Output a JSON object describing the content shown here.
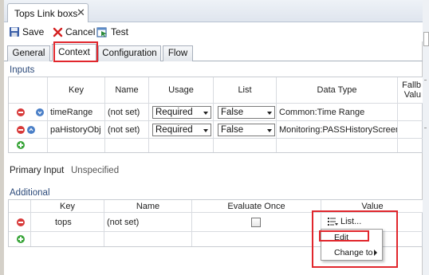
{
  "editor": {
    "tab_title": "Tops Link boxs"
  },
  "toolbar": {
    "save_label": "Save",
    "cancel_label": "Cancel",
    "test_label": "Test"
  },
  "subtabs": [
    "General",
    "Context",
    "Configuration",
    "Flow"
  ],
  "inputs": {
    "section_label": "Inputs",
    "columns": [
      "Key",
      "Name",
      "Usage",
      "List",
      "Data Type",
      "Fallb",
      "Valu"
    ],
    "rows": [
      {
        "key": "timeRange",
        "name": "(not set)",
        "usage": "Required",
        "list": "False",
        "data_type": "Common:Time Range"
      },
      {
        "key": "paHistoryObj",
        "name": "(not set)",
        "usage": "Required",
        "list": "False",
        "data_type": "Monitoring:PASSHistoryScreen"
      }
    ]
  },
  "primary_input": {
    "label": "Primary Input",
    "value": "Unspecified"
  },
  "additional": {
    "section_label": "Additional",
    "columns": [
      "Key",
      "Name",
      "Evaluate Once",
      "Value"
    ],
    "rows": [
      {
        "key": "tops",
        "name": "(not set)",
        "evaluate_once": false,
        "value": "List..."
      }
    ]
  },
  "context_menu": {
    "items": [
      "Edit",
      "Change to"
    ]
  },
  "colors": {
    "highlight": "#e1262c",
    "section_text": "#2c4a7a"
  }
}
